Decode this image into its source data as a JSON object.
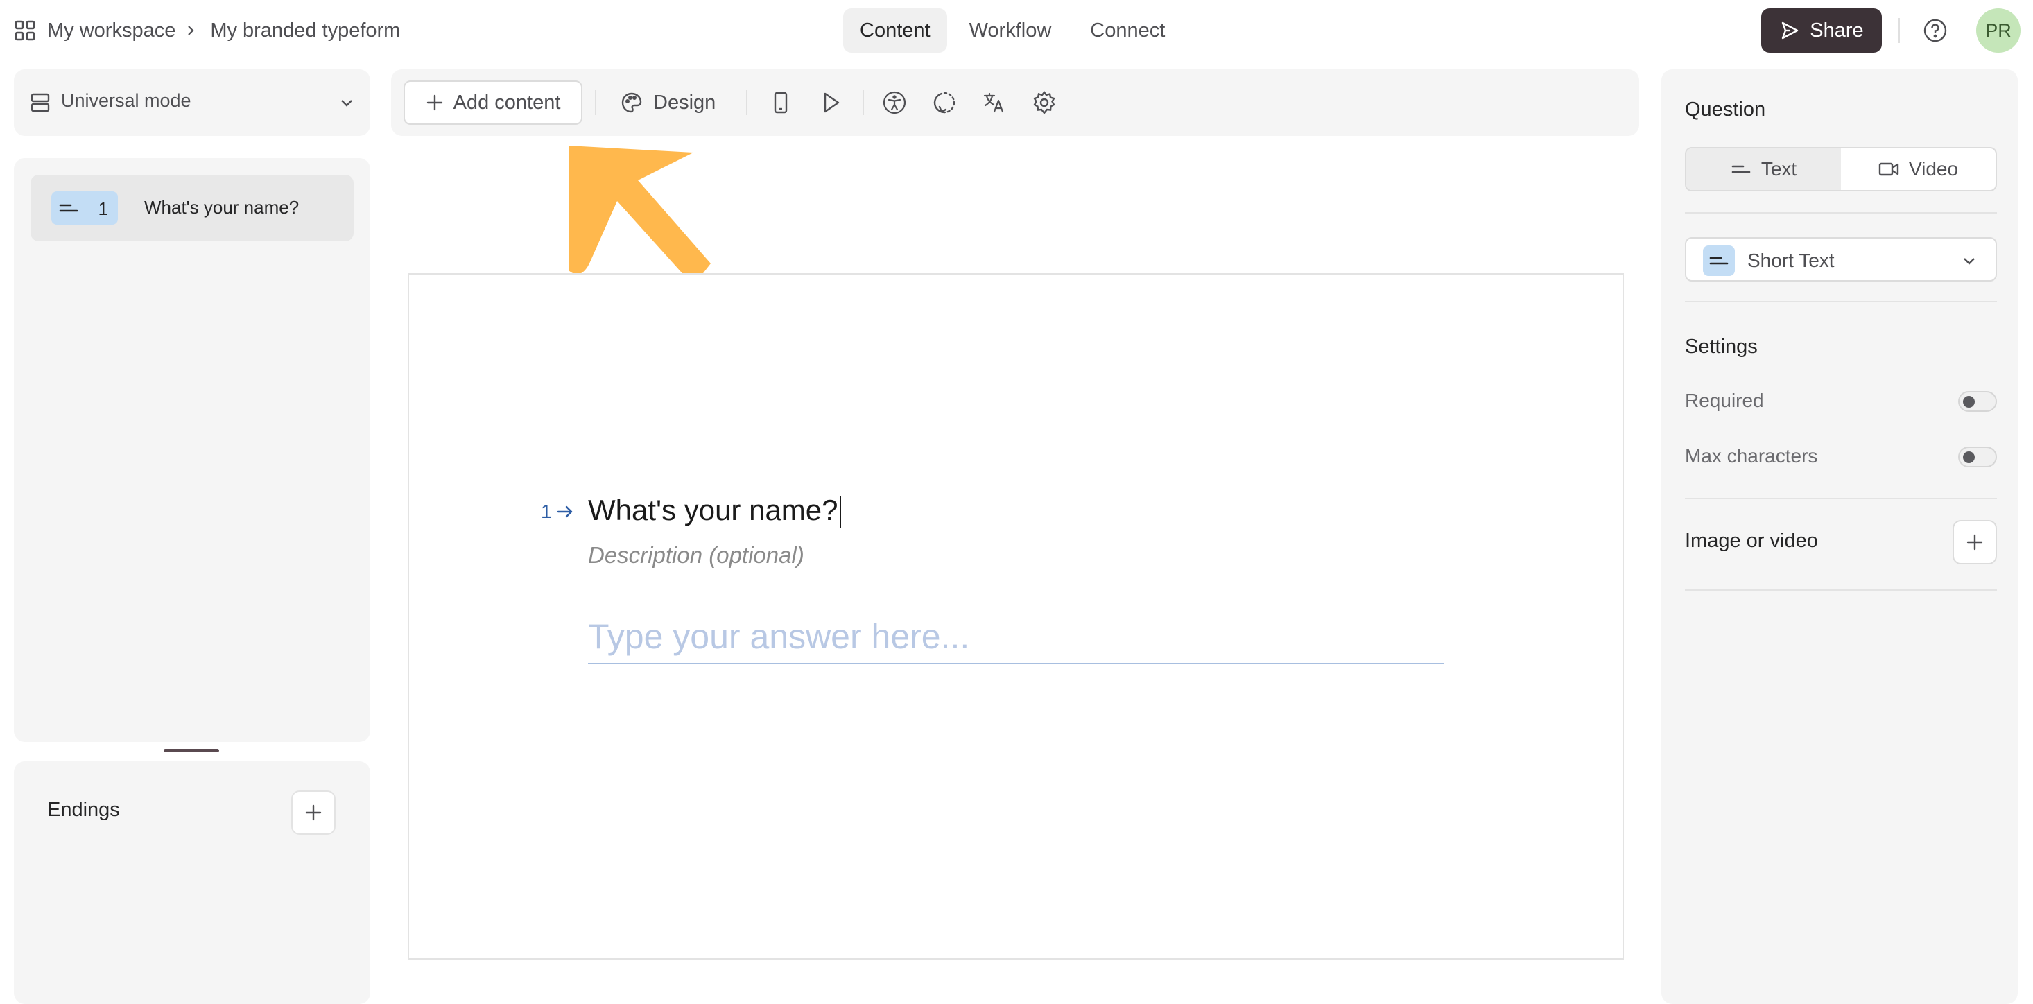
{
  "breadcrumb": {
    "workspace": "My workspace",
    "form": "My branded typeform"
  },
  "tabs": [
    {
      "label": "Content",
      "active": true
    },
    {
      "label": "Workflow",
      "active": false
    },
    {
      "label": "Connect",
      "active": false
    }
  ],
  "header": {
    "share_label": "Share",
    "avatar_initials": "PR"
  },
  "mode": {
    "label": "Universal mode"
  },
  "questions": [
    {
      "number": "1",
      "title": "What's your name?",
      "type_icon": "short-text-icon"
    }
  ],
  "endings": {
    "label": "Endings"
  },
  "toolbar": {
    "add_content": "Add content",
    "design": "Design"
  },
  "canvas": {
    "question_number": "1",
    "question_title": "What's your name?",
    "description_placeholder": "Description (optional)",
    "answer_placeholder": "Type your answer here..."
  },
  "right_panel": {
    "question_heading": "Question",
    "format_options": [
      {
        "label": "Text",
        "active": true
      },
      {
        "label": "Video",
        "active": false
      }
    ],
    "question_type": "Short Text",
    "settings_heading": "Settings",
    "settings": [
      {
        "label": "Required",
        "enabled": false
      },
      {
        "label": "Max characters",
        "enabled": false
      }
    ],
    "media_label": "Image or video"
  },
  "colors": {
    "accent_dark": "#3c3237",
    "badge_blue": "#c3ddf5",
    "annotation_arrow": "#ffb84d",
    "question_number": "#2d5da5"
  }
}
